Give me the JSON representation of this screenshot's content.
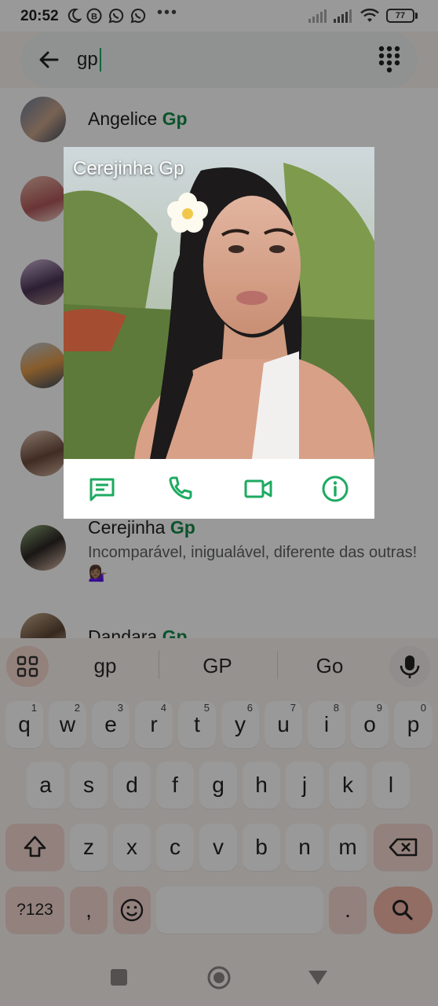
{
  "status_bar": {
    "time": "20:52",
    "battery": "77"
  },
  "search": {
    "query": "gp"
  },
  "contacts": [
    {
      "name": "Angelice",
      "highlight": "Gp",
      "status": ""
    },
    {
      "name": "Cerejinha",
      "highlight": "Gp",
      "status": "Incomparável, inigualável, diferente das outras!💁🏽‍♀️"
    },
    {
      "name": "Dandara",
      "highlight": "Gp",
      "status": ""
    }
  ],
  "popup": {
    "title": "Cerejinha Gp",
    "actions": [
      "message-icon",
      "call-icon",
      "video-call-icon",
      "info-icon"
    ]
  },
  "keyboard": {
    "suggestions": [
      "gp",
      "GP",
      "Go"
    ],
    "row1": [
      {
        "key": "q",
        "hint": "1"
      },
      {
        "key": "w",
        "hint": "2"
      },
      {
        "key": "e",
        "hint": "3"
      },
      {
        "key": "r",
        "hint": "4"
      },
      {
        "key": "t",
        "hint": "5"
      },
      {
        "key": "y",
        "hint": "6"
      },
      {
        "key": "u",
        "hint": "7"
      },
      {
        "key": "i",
        "hint": "8"
      },
      {
        "key": "o",
        "hint": "9"
      },
      {
        "key": "p",
        "hint": "0"
      }
    ],
    "row2": [
      "a",
      "s",
      "d",
      "f",
      "g",
      "h",
      "j",
      "k",
      "l"
    ],
    "row3": [
      "z",
      "x",
      "c",
      "v",
      "b",
      "n",
      "m"
    ],
    "symbols_label": "?123",
    "comma": ",",
    "period": "."
  },
  "colors": {
    "accent": "#1daa61",
    "highlight_text": "#138a4a",
    "keyboard_bg": "#fbf3f1",
    "key_accent": "#f2b6a6"
  }
}
